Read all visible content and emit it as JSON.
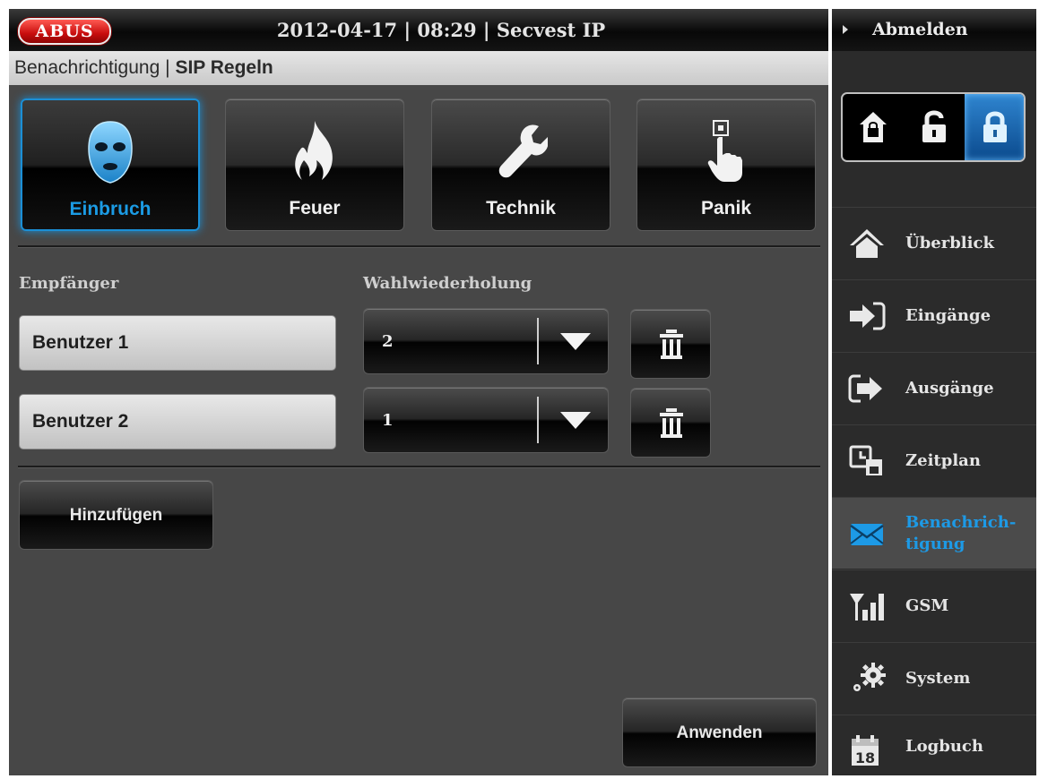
{
  "header": {
    "logo": "ABUS",
    "datetime": "2012-04-17  |  08:29  |  Secvest IP",
    "breadcrumb_main": "Benachrichtigung",
    "breadcrumb_sep": "|",
    "breadcrumb_sub": "SIP Regeln"
  },
  "categories": [
    {
      "label": "Einbruch",
      "icon": "burglar-mask-icon",
      "active": true
    },
    {
      "label": "Feuer",
      "icon": "fire-icon",
      "active": false
    },
    {
      "label": "Technik",
      "icon": "wrench-icon",
      "active": false
    },
    {
      "label": "Panik",
      "icon": "panic-button-icon",
      "active": false
    }
  ],
  "form": {
    "recipient_header": "Empfänger",
    "redial_header": "Wahlwiederholung",
    "rows": [
      {
        "recipient": "Benutzer 1",
        "redial": "2"
      },
      {
        "recipient": "Benutzer 2",
        "redial": "1"
      }
    ],
    "add_label": "Hinzufügen",
    "apply_label": "Anwenden"
  },
  "sidebar": {
    "logout": "Abmelden",
    "lock_modes": [
      {
        "icon": "lock-closed-house-icon",
        "active": false
      },
      {
        "icon": "lock-open-icon",
        "active": false
      },
      {
        "icon": "lock-closed-icon",
        "active": true
      }
    ],
    "items": [
      {
        "label": "Überblick",
        "icon": "house-icon",
        "active": false
      },
      {
        "label": "Eingänge",
        "icon": "input-arrow-icon",
        "active": false
      },
      {
        "label": "Ausgänge",
        "icon": "output-arrow-icon",
        "active": false
      },
      {
        "label": "Zeitplan",
        "icon": "schedule-icon",
        "active": false
      },
      {
        "label": "Benachrich-",
        "label2": "tigung",
        "icon": "envelope-icon",
        "active": true
      },
      {
        "label": "GSM",
        "icon": "signal-icon",
        "active": false
      },
      {
        "label": "System",
        "icon": "gears-icon",
        "active": false
      },
      {
        "label": "Logbuch",
        "icon": "calendar-icon",
        "active": false
      }
    ]
  },
  "colors": {
    "accent": "#1b9be4",
    "logo_red": "#c80d0d",
    "panel": "#474747",
    "sidebar": "#2b2b2b"
  }
}
